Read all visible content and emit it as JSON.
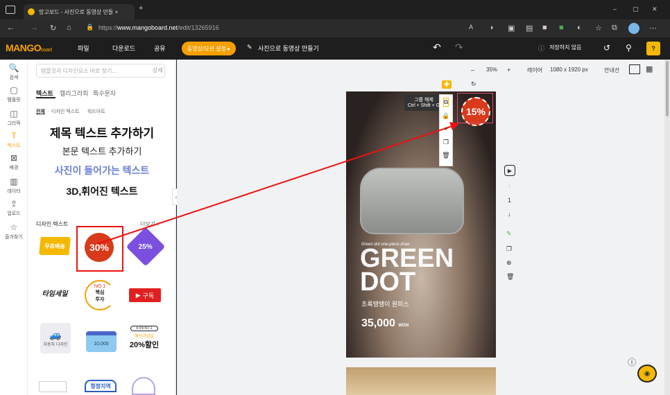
{
  "browser": {
    "tab_title": "망고보드 - 사진으로 동영상 만들 ×",
    "url_prefix": "https://",
    "url_domain": "www.mangoboard.net",
    "url_path": "/edit/13265916",
    "new_tab": "+",
    "min": "–",
    "max": "▢",
    "close": "✕"
  },
  "header": {
    "logo": "MANGO",
    "logo_sub": "board",
    "menu": [
      "파일",
      "다운로드",
      "공유"
    ],
    "mode_button": "동영상/모션 설정 ▸",
    "doc_title": "사진으로 동영상 만들기",
    "save_status": "저장하지 않음"
  },
  "rail": [
    {
      "label": "검색",
      "icon": "🔍"
    },
    {
      "label": "템플릿",
      "icon": "▢"
    },
    {
      "label": "그리픽",
      "icon": "◫"
    },
    {
      "label": "텍스트",
      "icon": "T"
    },
    {
      "label": "배경",
      "icon": "⊠"
    },
    {
      "label": "데이터",
      "icon": "▥"
    },
    {
      "label": "업로드",
      "icon": "⇪"
    },
    {
      "label": "즐겨찾기",
      "icon": "☆"
    }
  ],
  "panel": {
    "search_placeholder": "템플릿과 디자인요소 바로 찾기...",
    "search_detail": "상세",
    "tabs": [
      "텍스트",
      "캘리그라피",
      "특수문자"
    ],
    "subtabs": [
      "전체",
      "디자인 텍스트",
      "워드아트"
    ],
    "add_title": "제목 텍스트 추가하기",
    "add_body": "본문 텍스트 추가하기",
    "add_photo": "사진이 들어가는 텍스트",
    "add_3d": "3D,휘어진 텍스트",
    "design_heading": "디자인 텍스트",
    "more": "더보기 ›"
  },
  "stickers": {
    "s1": "무료배송",
    "s2": "30%",
    "s3": "25%",
    "s4": "타임세일",
    "s5a": "NO.1",
    "s5b": "핵심",
    "s5c": "투자",
    "s6": "구독",
    "s8": "10,000",
    "s9a": "EVENT1",
    "s9b": "애인기념일",
    "s9c": "20%할인",
    "s10": "청정지역",
    "s7": "자동차 디자인"
  },
  "canvas": {
    "zoom": "35%",
    "layer": "레이어",
    "size": "1080 x 1920 px",
    "guide": "안내선",
    "group_tip": "그룹 해제",
    "group_shortcut": "Ctrl + Shift + G",
    "badge": "15%",
    "script": "Green dot one-piece draw",
    "headline1": "GREEN",
    "headline2": "DOT",
    "subtitle": "초록땡땡이 원피스",
    "price": "35,000",
    "won": "WON",
    "page_num": "1"
  },
  "colors": {
    "accent": "#f5a000",
    "sticker_red": "#d83a1b",
    "annotation": "#e11"
  }
}
